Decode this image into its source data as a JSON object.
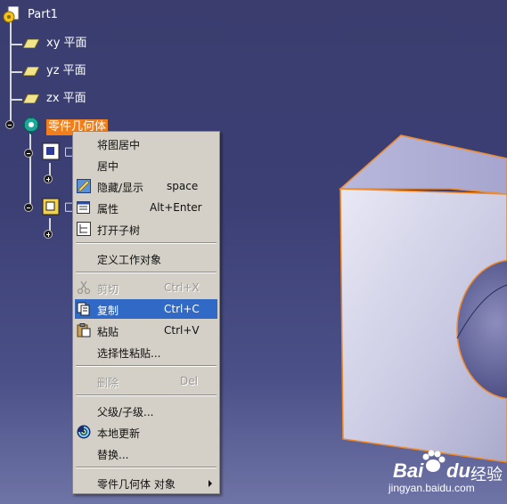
{
  "tree": {
    "root": "Part1",
    "planes": [
      "xy 平面",
      "yz 平面",
      "zx 平面"
    ],
    "selected_node": "零件几何体",
    "child_nodes_partial": [
      "□",
      "□"
    ]
  },
  "context_menu": {
    "items": [
      {
        "label": "将图居中",
        "shortcut": "",
        "icon": "",
        "state": "normal"
      },
      {
        "label": "居中",
        "shortcut": "",
        "icon": "",
        "state": "normal"
      },
      {
        "label": "隐藏/显示",
        "shortcut": "space",
        "icon": "hide-show-icon",
        "state": "normal"
      },
      {
        "label": "属性",
        "shortcut": "Alt+Enter",
        "icon": "properties-icon",
        "state": "normal"
      },
      {
        "label": "打开子树",
        "shortcut": "",
        "icon": "subtree-icon",
        "state": "normal"
      },
      {
        "label": "定义工作对象",
        "shortcut": "",
        "icon": "",
        "state": "normal"
      },
      {
        "label": "剪切",
        "shortcut": "Ctrl+X",
        "icon": "scissors-icon",
        "state": "disabled"
      },
      {
        "label": "复制",
        "shortcut": "Ctrl+C",
        "icon": "copy-icon",
        "state": "highlighted"
      },
      {
        "label": "粘贴",
        "shortcut": "Ctrl+V",
        "icon": "paste-icon",
        "state": "normal"
      },
      {
        "label": "选择性粘贴...",
        "shortcut": "",
        "icon": "",
        "state": "normal"
      },
      {
        "label": "删除",
        "shortcut": "Del",
        "icon": "",
        "state": "disabled"
      },
      {
        "label": "父级/子级...",
        "shortcut": "",
        "icon": "",
        "state": "normal"
      },
      {
        "label": "本地更新",
        "shortcut": "",
        "icon": "local-update-icon",
        "state": "normal"
      },
      {
        "label": "替换...",
        "shortcut": "",
        "icon": "",
        "state": "normal"
      },
      {
        "label": "零件几何体 对象",
        "shortcut": "",
        "icon": "",
        "state": "submenu"
      }
    ]
  },
  "watermark": {
    "brand_a": "Bai",
    "brand_b": "du",
    "brand_c": "经验",
    "url": "jingyan.baidu.com"
  },
  "colors": {
    "viewport_background": "#3a3d6e",
    "menu_background": "#d4d0c8",
    "menu_highlight": "#3169c6",
    "selected_node_background": "#f07f1b",
    "model_face": "#c9c9e4",
    "model_edge": "#f08a2a"
  }
}
